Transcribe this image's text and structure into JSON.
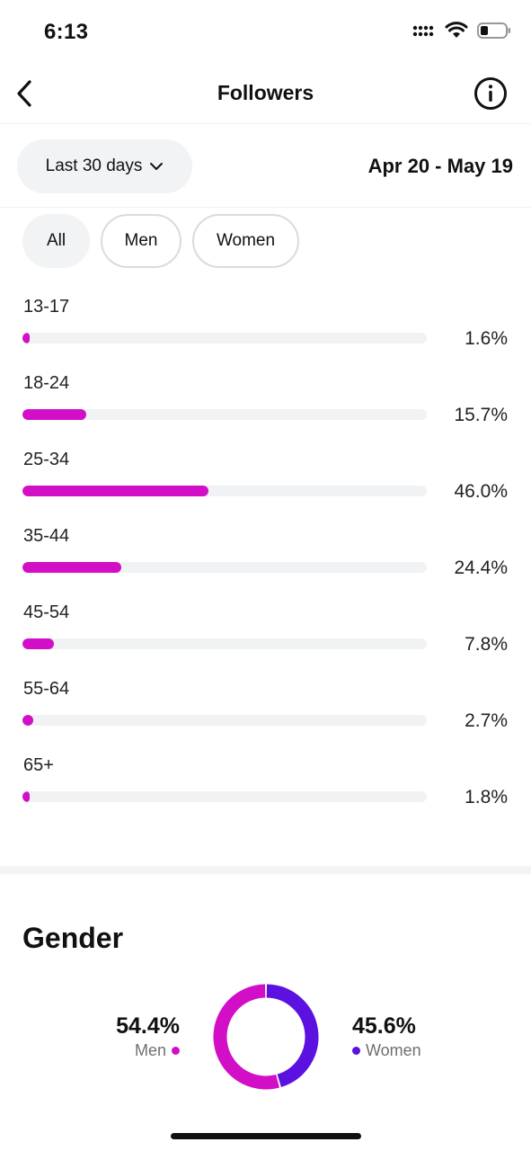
{
  "status_bar": {
    "time": "6:13"
  },
  "nav": {
    "title": "Followers"
  },
  "range": {
    "selected": "Last 30 days",
    "dates": "Apr 20 - May 19"
  },
  "filters": [
    {
      "label": "All",
      "active": true
    },
    {
      "label": "Men",
      "active": false
    },
    {
      "label": "Women",
      "active": false
    }
  ],
  "age_ranges": [
    {
      "label": "13-17",
      "value": "1.6%",
      "percent": 1.6
    },
    {
      "label": "18-24",
      "value": "15.7%",
      "percent": 15.7
    },
    {
      "label": "25-34",
      "value": "46.0%",
      "percent": 46.0
    },
    {
      "label": "35-44",
      "value": "24.4%",
      "percent": 24.4
    },
    {
      "label": "45-54",
      "value": "7.8%",
      "percent": 7.8
    },
    {
      "label": "55-64",
      "value": "2.7%",
      "percent": 2.7
    },
    {
      "label": "65+",
      "value": "1.8%",
      "percent": 1.8
    }
  ],
  "gender": {
    "title": "Gender",
    "men": {
      "value": "54.4%",
      "label": "Men",
      "percent": 54.4,
      "color": "#d20fc6"
    },
    "women": {
      "value": "45.6%",
      "label": "Women",
      "percent": 45.6,
      "color": "#5b12e0"
    }
  },
  "colors": {
    "accent": "#d20fc6",
    "track": "#f1f2f4",
    "chip_bg": "#f2f3f5"
  }
}
